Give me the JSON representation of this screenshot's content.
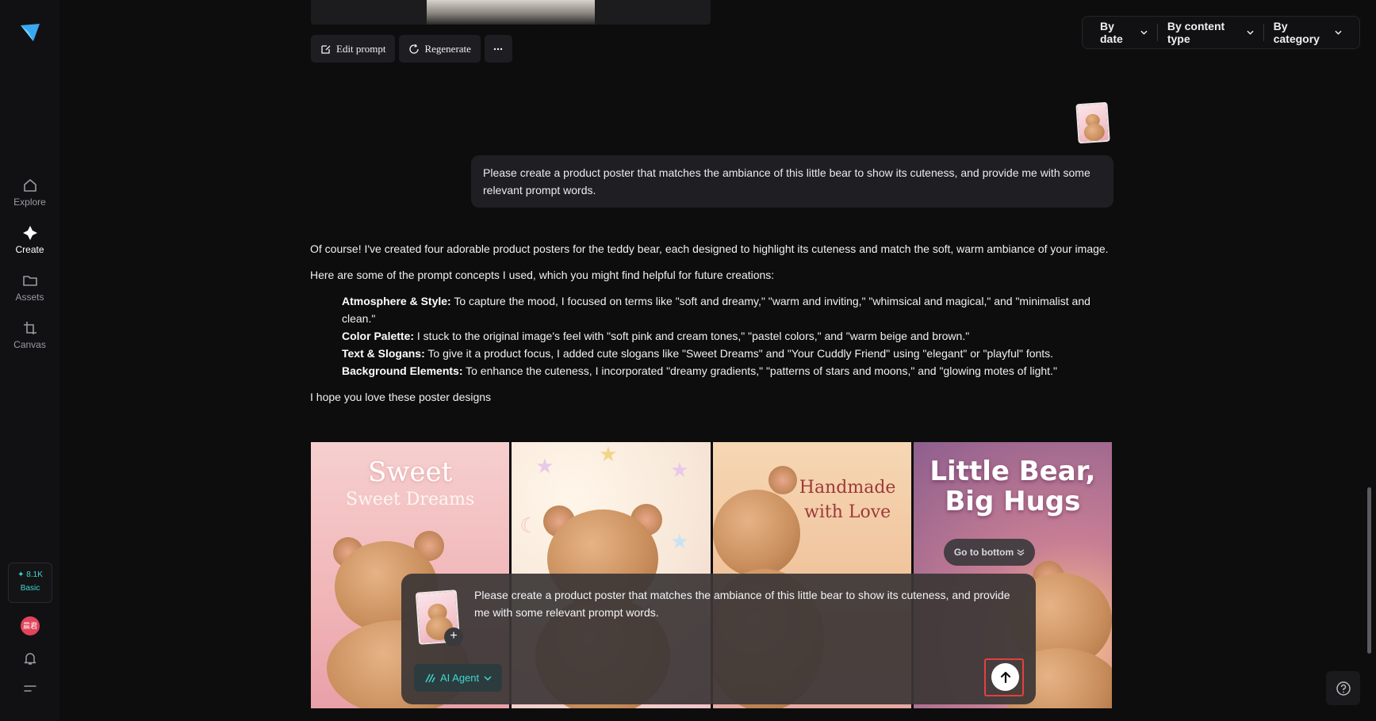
{
  "sidebar": {
    "items": [
      {
        "label": "Explore",
        "icon": "home-icon"
      },
      {
        "label": "Create",
        "icon": "sparkle-icon"
      },
      {
        "label": "Assets",
        "icon": "folder-icon"
      },
      {
        "label": "Canvas",
        "icon": "crop-icon"
      }
    ],
    "credits": {
      "amount": "8.1K",
      "plan": "Basic"
    },
    "avatar_text": "晨君"
  },
  "filters": {
    "date": "By date",
    "content_type": "By content type",
    "category": "By category"
  },
  "actions": {
    "edit_prompt": "Edit prompt",
    "regenerate": "Regenerate"
  },
  "user_message": "Please create a product poster that matches the ambiance of this little bear to show its cuteness, and provide me with some relevant prompt words.",
  "assistant": {
    "intro": "Of course! I've created four adorable product posters for the teddy bear, each designed to highlight its cuteness and match the soft, warm ambiance of your image.",
    "concepts_lead": "Here are some of the prompt concepts I used, which you might find helpful for future creations:",
    "concepts": [
      {
        "title": "Atmosphere & Style:",
        "text": " To capture the mood, I focused on terms like \"soft and dreamy,\" \"warm and inviting,\" \"whimsical and magical,\" and \"minimalist and clean.\""
      },
      {
        "title": "Color Palette:",
        "text": " I stuck to the original image's feel with \"soft pink and cream tones,\" \"pastel colors,\" and \"warm beige and brown.\""
      },
      {
        "title": "Text & Slogans:",
        "text": " To give it a product focus, I added cute slogans like \"Sweet Dreams\" and \"Your Cuddly Friend\" using \"elegant\" or \"playful\" fonts."
      },
      {
        "title": "Background Elements:",
        "text": " To enhance the cuteness, I incorporated \"dreamy gradients,\" \"patterns of stars and moons,\" and \"glowing motes of light.\""
      }
    ],
    "closing": "I hope you love these poster designs"
  },
  "posters": [
    {
      "line1": "Sweet",
      "line2": "Sweet Dreams"
    },
    {
      "line1": "",
      "line2": ""
    },
    {
      "line1": "Handmade",
      "line2": "with Love"
    },
    {
      "line1": "Little Bear,",
      "line2": "Big Hugs"
    }
  ],
  "go_to_bottom": "Go to bottom",
  "composer": {
    "text": "Please create a product poster that matches the ambiance of this little bear to show its cuteness, and provide me with some relevant prompt words.",
    "agent_label": "AI Agent"
  },
  "colors": {
    "accent": "#3fd7ce",
    "send_highlight": "#e24040"
  }
}
